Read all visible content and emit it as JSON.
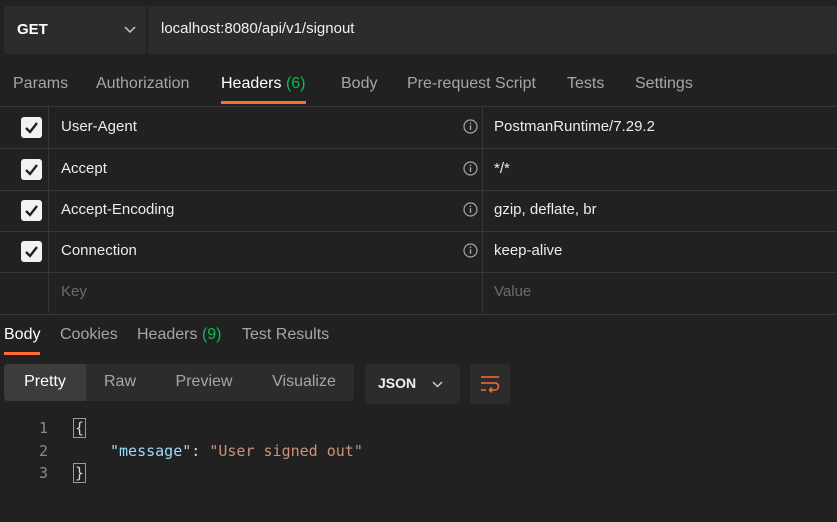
{
  "request": {
    "method": "GET",
    "url": "localhost:8080/api/v1/signout"
  },
  "request_tabs": {
    "params": "Params",
    "authorization": "Authorization",
    "headers": "Headers",
    "headers_count": "(6)",
    "body": "Body",
    "prerequest": "Pre-request Script",
    "tests": "Tests",
    "settings": "Settings"
  },
  "headers": [
    {
      "key": "User-Agent",
      "value": "PostmanRuntime/7.29.2"
    },
    {
      "key": "Accept",
      "value": "*/*"
    },
    {
      "key": "Accept-Encoding",
      "value": "gzip, deflate, br"
    },
    {
      "key": "Connection",
      "value": "keep-alive"
    }
  ],
  "new_header": {
    "key_placeholder": "Key",
    "value_placeholder": "Value"
  },
  "response_tabs": {
    "body": "Body",
    "cookies": "Cookies",
    "headers": "Headers",
    "headers_count": "(9)",
    "test_results": "Test Results"
  },
  "view_modes": {
    "pretty": "Pretty",
    "raw": "Raw",
    "preview": "Preview",
    "visualize": "Visualize"
  },
  "format": "JSON",
  "code": {
    "line1": "1",
    "line2": "2",
    "line3": "3",
    "open_brace": "{",
    "key": "\"message\"",
    "colon": ": ",
    "value": "\"User signed out\"",
    "close_brace": "}"
  },
  "colors": {
    "accent": "#ff6c37",
    "count_green": "#0cbb52",
    "background": "#212121"
  }
}
